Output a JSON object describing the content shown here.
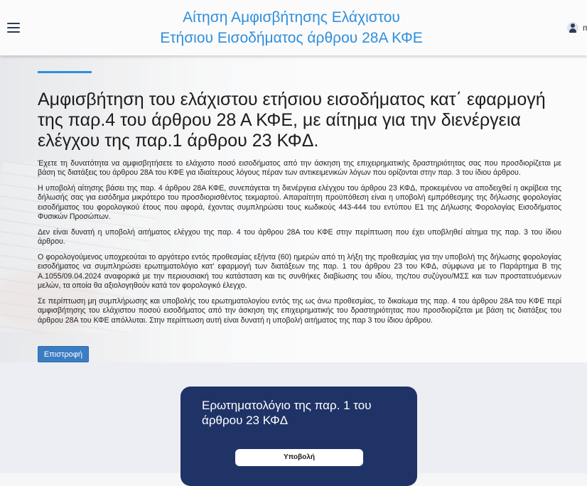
{
  "header": {
    "title_line1": "Αίτηση Αμφισβήτησης Ελάχιστου",
    "title_line2": "Ετήσιου Εισοδήματος άρθρου 28Α ΚΦΕ",
    "user_name": "m",
    "menu_icon": "hamburger-icon",
    "user_icon": "user-icon"
  },
  "main": {
    "title": "Αμφισβήτηση του ελάχιστου ετήσιου εισοδήματος κατ΄ εφαρμογή της παρ.4 του άρθρου 28 Α ΚΦΕ, με αίτημα για την διενέργεια ελέγχου της παρ.1 άρθρου 23 ΚΦΔ.",
    "paragraphs": [
      "Έχετε τη δυνατότητα να αμφισβητήσετε το ελάχιστο ποσό εισοδήματος από την άσκηση της επιχειρηματικής δραστηριότητας σας που προσδιορίζεται με βάση τις διατάξεις του άρθρου 28Α του ΚΦΕ για ιδιαίτερους λόγους πέραν των αντικειμενικών λόγων που ορίζονται στην παρ. 3 του ίδιου άρθρου.",
      "Η υποβολή αίτησης βάσει της παρ. 4 άρθρου 28Α ΚΦΕ, συνεπάγεται τη διενέργεια ελέγχου του άρθρου 23 ΚΦΔ, προκειμένου να αποδειχθεί η ακρίβεια της δήλωσής σας για εισόδημα μικρότερο του προσδιορισθέντος τεκμαρτού. Απαραίτητη προϋπόθεση είναι η υποβολή εμπρόθεσμης της δήλωσης φορολογίας εισοδήματος του φορολογικού έτους που αφορά, έχοντας συμπληρώσει τους κωδικούς 443-444 του εντύπου Ε1 της Δήλωσης Φορολογίας Εισοδήματος Φυσικών Προσώπων.",
      "Δεν είναι δυνατή η υποβολή αιτήματος ελέγχου της παρ. 4 του άρθρου 28Α του ΚΦΕ στην περίπτωση που έχει υποβληθεί αίτημα της παρ. 3 του ίδιου άρθρου.",
      "Ο φορολογούμενος υποχρεούται το αργότερο εντός προθεσμίας εξήντα (60) ημερών από τη λήξη της προθεσμίας για την υποβολή της δήλωσης φορολογίας εισοδήματος να συμπληρώσει ερωτηματολόγιο κατ' εφαρμογή των διατάξεων της παρ. 1 του άρθρου 23 του ΚΦΔ, σύμφωνα με το Παράρτημα Β της Α.1055/09.04.2024 αναφορικά με την περιουσιακή του κατάσταση και τις συνθήκες διαβίωσης του ιδίου, της/του συζύγου/ΜΣΣ και των προστατευόμενων μελών, τα οποία θα αξιολογηθούν κατά τον φορολογικό έλεγχο.",
      "Σε περίπτωση μη συμπλήρωσης και υποβολής του ερωτηματολογίου εντός της ως άνω προθεσμίας, το δικαίωμα της παρ. 4 του άρθρου 28Α του ΚΦΕ περί αμφισβήτησης του ελάχιστου ποσού εισοδήματος από την άσκηση της επιχειρηματικής του δραστηριότητας που προσδιορίζεται με βάση τις διατάξεις του άρθρου 28Α του ΚΦΕ απόλλυται. Στην περίπτωση αυτή είναι δυνατή η υποβολή αιτήματος της παρ 3 του ίδιου άρθρου."
    ],
    "back_label": "Επιστροφή"
  },
  "card": {
    "title": "Ερωτηματολόγιο της παρ. 1 του άρθρου 23 ΚΦΔ",
    "submit_label": "Υποβολή"
  },
  "colors": {
    "accent": "#2f8fdb",
    "card_bg": "#1f3366",
    "button_bg": "#3b7dc2"
  }
}
